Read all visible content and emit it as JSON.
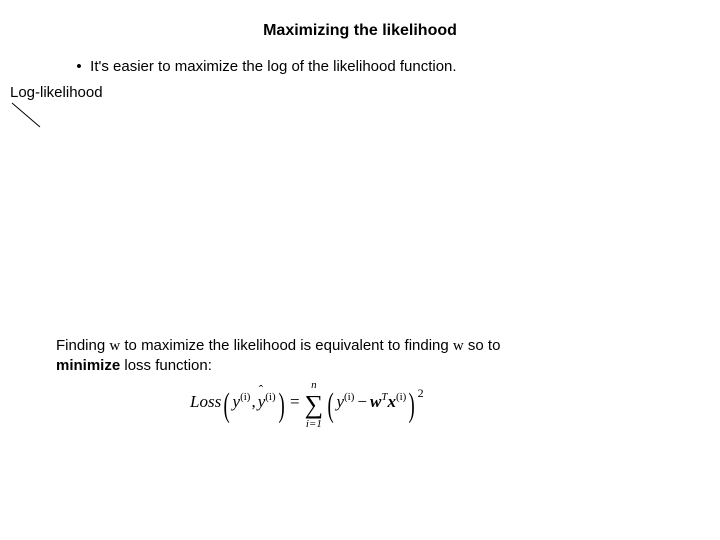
{
  "title": "Maximizing the likelihood",
  "bullet": {
    "marker": "•",
    "text": "It's easier to maximize the log of the likelihood function."
  },
  "loglik_label": "Log-likelihood",
  "para": {
    "p1a": "Finding ",
    "w1": "w",
    "p1b": " to maximize the likelihood is equivalent to finding ",
    "w2": "w",
    "p1c": " so to ",
    "min": "minimize",
    "p1d": " loss function:"
  },
  "formula": {
    "loss": "Loss",
    "y": "y",
    "sup_i": "(i)",
    "yhat": "y",
    "n": "n",
    "i1": "i=1",
    "w": "w",
    "T": "T",
    "x": "x",
    "two": "2",
    "eq": "=",
    "minus": "−",
    "comma": ","
  }
}
